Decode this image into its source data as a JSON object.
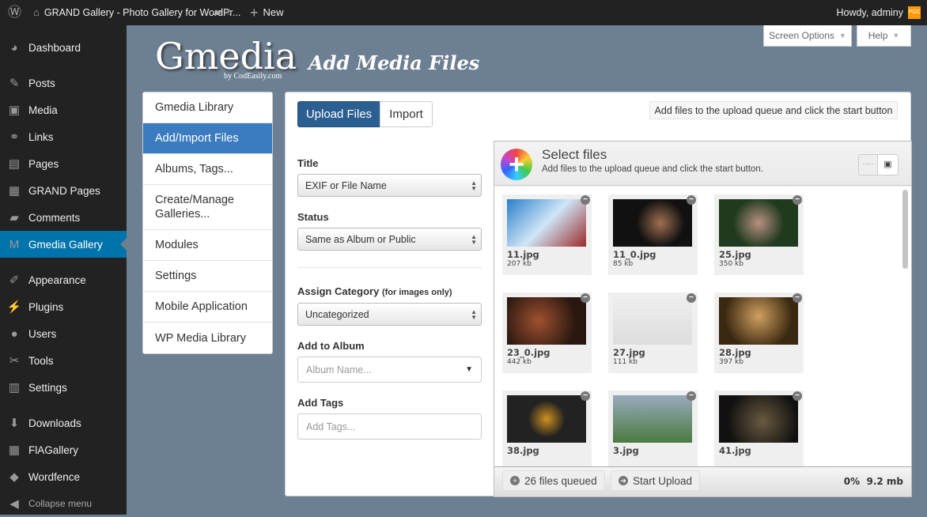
{
  "adminbar": {
    "site_title": "GRAND Gallery - Photo Gallery for WordPr...",
    "comments": "0",
    "new": "New",
    "howdy": "Howdy, adminy",
    "avatar": "PGC"
  },
  "sidebar": {
    "items": [
      {
        "label": "Dashboard",
        "icon": "◕"
      },
      {
        "label": "Posts",
        "icon": "✎"
      },
      {
        "label": "Media",
        "icon": "▣"
      },
      {
        "label": "Links",
        "icon": "⚭"
      },
      {
        "label": "Pages",
        "icon": "▤"
      },
      {
        "label": "GRAND Pages",
        "icon": "▦"
      },
      {
        "label": "Comments",
        "icon": "▰"
      },
      {
        "label": "Gmedia Gallery",
        "icon": "M"
      },
      {
        "label": "Appearance",
        "icon": "✐"
      },
      {
        "label": "Plugins",
        "icon": "⚡"
      },
      {
        "label": "Users",
        "icon": "●"
      },
      {
        "label": "Tools",
        "icon": "✂"
      },
      {
        "label": "Settings",
        "icon": "▥"
      },
      {
        "label": "Downloads",
        "icon": "⬇"
      },
      {
        "label": "FlAGallery",
        "icon": "▦"
      },
      {
        "label": "Wordfence",
        "icon": "◆"
      },
      {
        "label": "Collapse menu",
        "icon": "◀"
      }
    ]
  },
  "header": {
    "logo": "Gmedia",
    "logo_sub": "by CodEasily.com",
    "title": "Add Media Files",
    "screen_options": "Screen Options",
    "help": "Help"
  },
  "gnav": [
    "Gmedia Library",
    "Add/Import Files",
    "Albums, Tags...",
    "Create/Manage Galleries...",
    "Modules",
    "Settings",
    "Mobile Application",
    "WP Media Library"
  ],
  "tabs": {
    "upload": "Upload Files",
    "import": "Import"
  },
  "hint": "Add files to the upload queue and click the start button",
  "form": {
    "title_label": "Title",
    "title_value": "EXIF or File Name",
    "status_label": "Status",
    "status_value": "Same as Album or Public",
    "category_label": "Assign Category",
    "category_note": "(for images only)",
    "category_value": "Uncategorized",
    "album_label": "Add to Album",
    "album_placeholder": "Album Name...",
    "tags_label": "Add Tags",
    "tags_placeholder": "Add Tags..."
  },
  "uploader": {
    "title": "Select files",
    "subtitle": "Add files to the upload queue and click the start button.",
    "files": [
      {
        "name": "11.jpg",
        "size": "207 kb"
      },
      {
        "name": "11_0.jpg",
        "size": "85 kb"
      },
      {
        "name": "25.jpg",
        "size": "350 kb"
      },
      {
        "name": "23_0.jpg",
        "size": "442 kb"
      },
      {
        "name": "27.jpg",
        "size": "111 kb"
      },
      {
        "name": "28.jpg",
        "size": "397 kb"
      },
      {
        "name": "38.jpg",
        "size": ""
      },
      {
        "name": "3.jpg",
        "size": ""
      },
      {
        "name": "41.jpg",
        "size": ""
      }
    ],
    "queued": "26 files queued",
    "start": "Start Upload",
    "percent": "0%",
    "total": "9.2 mb"
  }
}
